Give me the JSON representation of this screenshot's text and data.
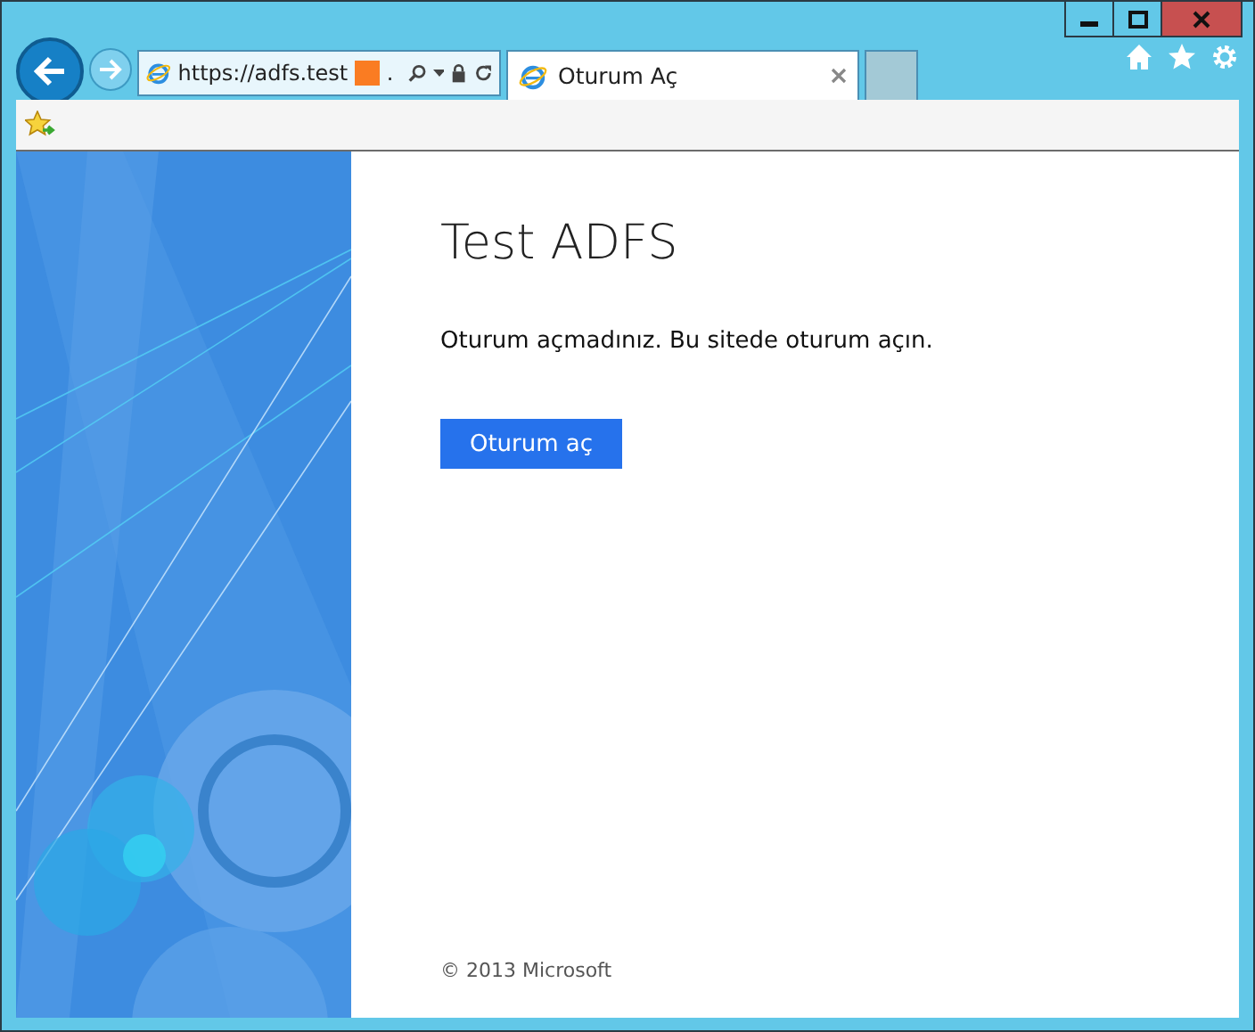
{
  "browser": {
    "address": {
      "text": "https://adfs.test",
      "redacted": true,
      "suffix": "."
    },
    "tabs": [
      {
        "label": "Oturum Aç",
        "selected": true,
        "kind": "page"
      },
      {
        "selected": false,
        "kind": "new"
      }
    ]
  },
  "page": {
    "title": "Test ADFS",
    "message": "Oturum açmadınız. Bu sitede oturum açın.",
    "button": "Oturum aç",
    "footer": "© 2013 Microsoft"
  }
}
